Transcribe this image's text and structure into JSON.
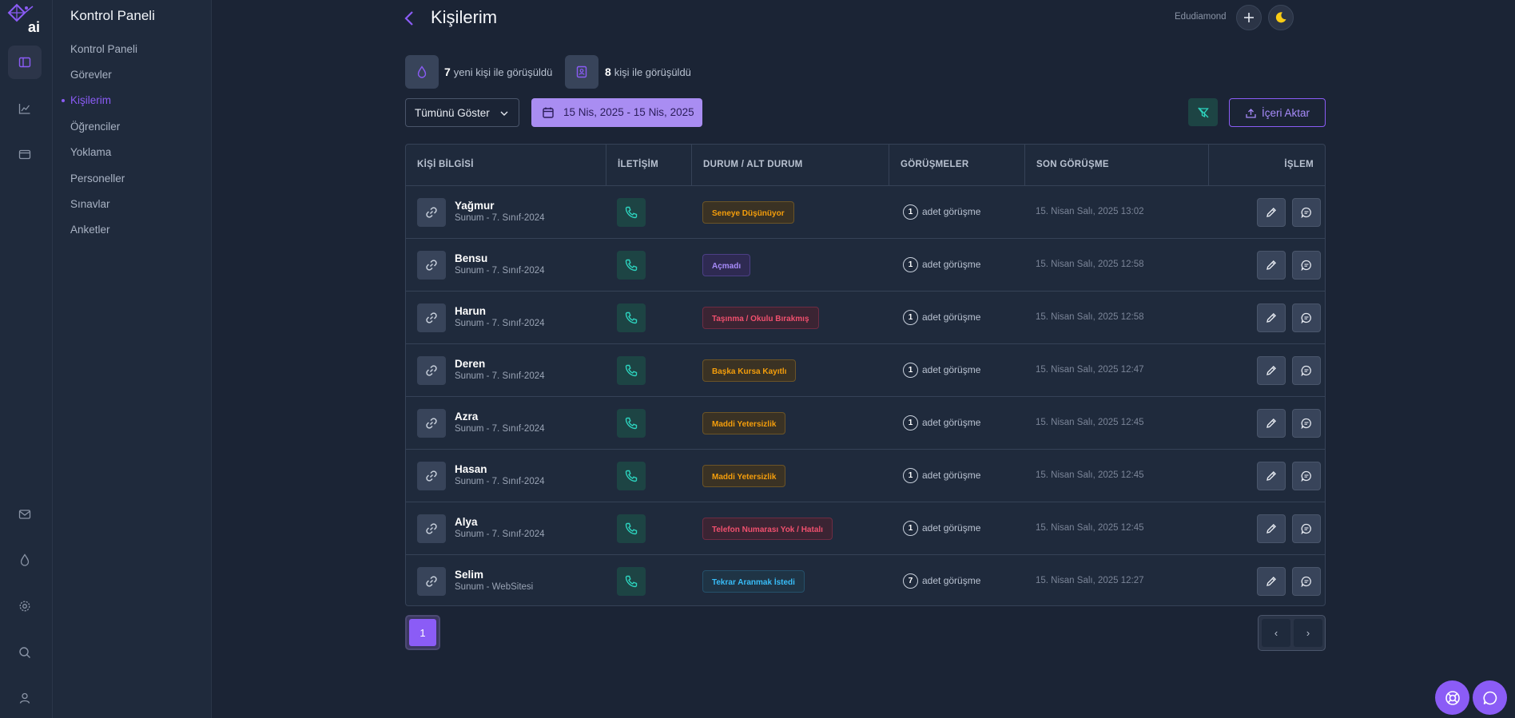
{
  "sidebar": {
    "title": "Kontrol Paneli",
    "items": [
      {
        "label": "Kontrol Paneli"
      },
      {
        "label": "Görevler"
      },
      {
        "label": "Kişilerim"
      },
      {
        "label": "Öğrenciler"
      },
      {
        "label": "Yoklama"
      },
      {
        "label": "Personeller"
      },
      {
        "label": "Sınavlar"
      },
      {
        "label": "Anketler"
      }
    ],
    "active_index": 2
  },
  "header": {
    "title": "Kişilerim",
    "user": "Edudiamond"
  },
  "stats": [
    {
      "count": "7",
      "label": "yeni kişi ile görüşüldü"
    },
    {
      "count": "8",
      "label": "kişi ile görüşüldü"
    }
  ],
  "filters": {
    "select_value": "Tümünü Göster",
    "date_range": "15 Nis, 2025 - 15 Nis, 2025",
    "import_label": "İçeri Aktar"
  },
  "table": {
    "columns": [
      "KİŞİ BİLGİSİ",
      "İLETİŞİM",
      "DURUM / ALT DURUM",
      "GÖRÜŞMELER",
      "SON GÖRÜŞME",
      "İŞLEM"
    ],
    "rows": [
      {
        "name": "Yağmur",
        "sub": "Sunum - 7. Sınıf-2024",
        "status": "Seneye Düşünüyor",
        "count": "1",
        "count_label": "adet görüşme",
        "last": "15. Nisan Salı, 2025 13:02"
      },
      {
        "name": "Bensu",
        "sub": "Sunum - 7. Sınıf-2024",
        "status": "Açmadı",
        "count": "1",
        "count_label": "adet görüşme",
        "last": "15. Nisan Salı, 2025 12:58"
      },
      {
        "name": "Harun",
        "sub": "Sunum - 7. Sınıf-2024",
        "status": "Taşınma / Okulu Bırakmış",
        "count": "1",
        "count_label": "adet görüşme",
        "last": "15. Nisan Salı, 2025 12:58"
      },
      {
        "name": "Deren",
        "sub": "Sunum - 7. Sınıf-2024",
        "status": "Başka Kursa Kayıtlı",
        "count": "1",
        "count_label": "adet görüşme",
        "last": "15. Nisan Salı, 2025 12:47"
      },
      {
        "name": "Azra",
        "sub": "Sunum - 7. Sınıf-2024",
        "status": "Maddi Yetersizlik",
        "count": "1",
        "count_label": "adet görüşme",
        "last": "15. Nisan Salı, 2025 12:45"
      },
      {
        "name": "Hasan",
        "sub": "Sunum - 7. Sınıf-2024",
        "status": "Maddi Yetersizlik",
        "count": "1",
        "count_label": "adet görüşme",
        "last": "15. Nisan Salı, 2025 12:45"
      },
      {
        "name": "Alya",
        "sub": "Sunum - 7. Sınıf-2024",
        "status": "Telefon Numarası Yok / Hatalı",
        "count": "1",
        "count_label": "adet görüşme",
        "last": "15. Nisan Salı, 2025 12:45"
      },
      {
        "name": "Selim",
        "sub": "Sunum - WebSitesi",
        "status": "Tekrar Aranmak İstedi",
        "count": "7",
        "count_label": "adet görüşme",
        "last": "15. Nisan Salı, 2025 12:27"
      }
    ]
  },
  "pagination": {
    "current": "1",
    "prev": "‹",
    "next": "›"
  },
  "colors": {
    "accent": "#8b5cf6",
    "status_orange": "#f59e0b",
    "status_purple": "#a78bfa",
    "status_red": "#f0506e",
    "status_blue": "#38bdf8",
    "phone_green": "#2dd4bf"
  }
}
